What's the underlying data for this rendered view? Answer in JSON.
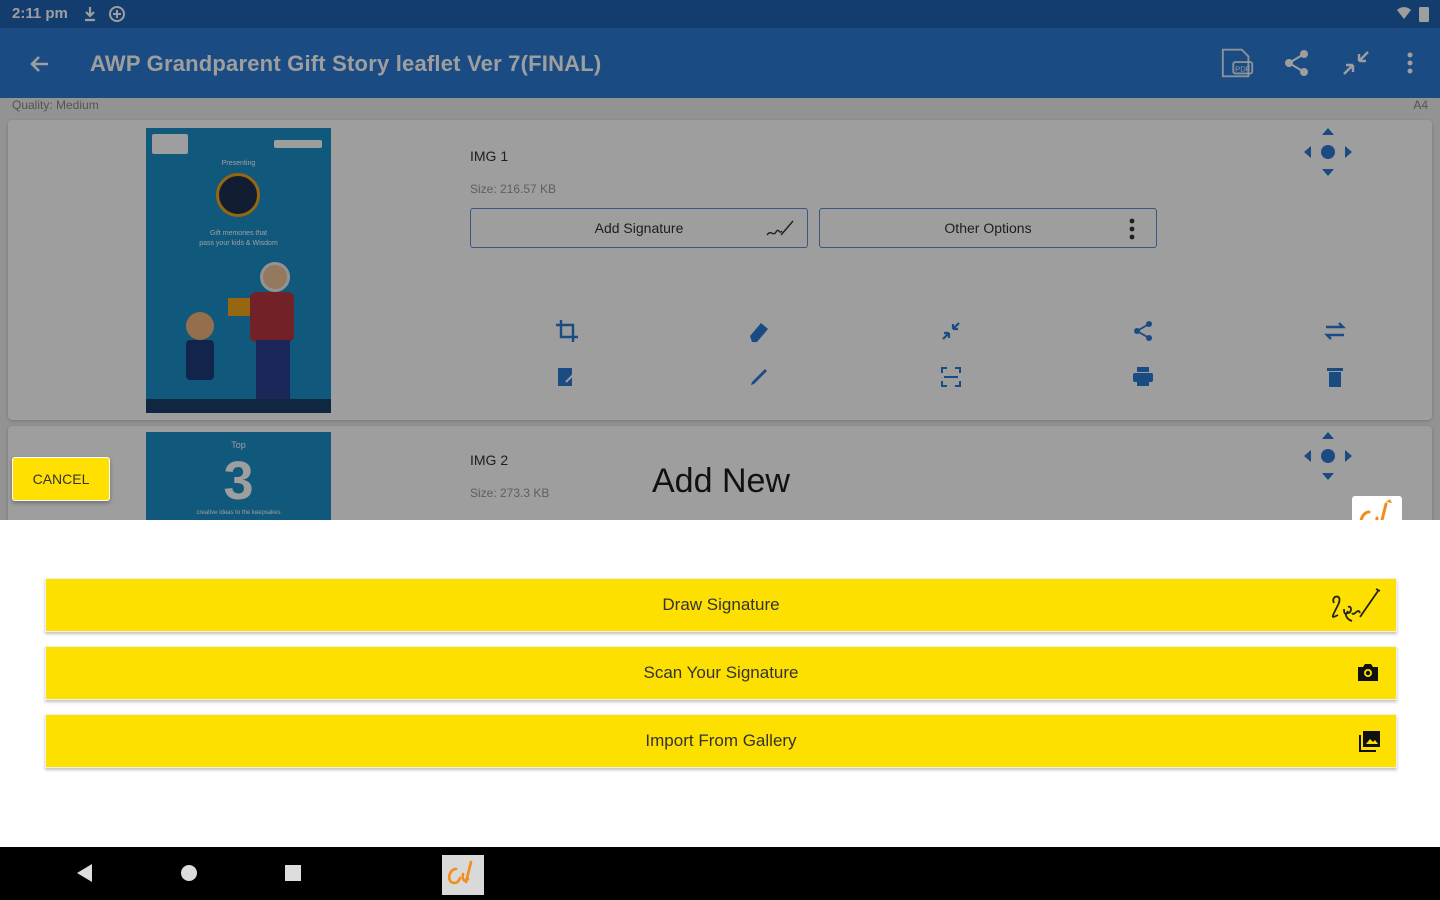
{
  "status_bar": {
    "time": "2:11 pm"
  },
  "toolbar": {
    "title": "AWP Grandparent Gift Story leaflet Ver 7(FINAL)"
  },
  "list_header": {
    "quality": "Quality: Medium",
    "paper": "A4"
  },
  "images": [
    {
      "name": "IMG 1",
      "size": "Size: 216.57 KB",
      "add_signature_label": "Add Signature",
      "other_options_label": "Other Options",
      "thumb_lines": [
        "Presenting",
        "Gift memories that",
        "pass your kids & Wisdom"
      ]
    },
    {
      "name": "IMG 2",
      "size": "Size: 273.3 KB",
      "thumb_top": "Top",
      "thumb_number": "3",
      "thumb_bottom": "creative ideas to the keepsakes"
    }
  ],
  "dialog": {
    "title": "Add New",
    "cancel_label": "CANCEL",
    "options": [
      {
        "label": "Draw Signature",
        "icon": "signature-icon"
      },
      {
        "label": "Scan Your Signature",
        "icon": "camera-icon"
      },
      {
        "label": "Import From Gallery",
        "icon": "gallery-icon"
      }
    ]
  },
  "colors": {
    "app_bar": "#2a79d3",
    "status_bar": "#1f63b3",
    "accent": "#ffe000",
    "brand_orange": "#f28c1c"
  }
}
